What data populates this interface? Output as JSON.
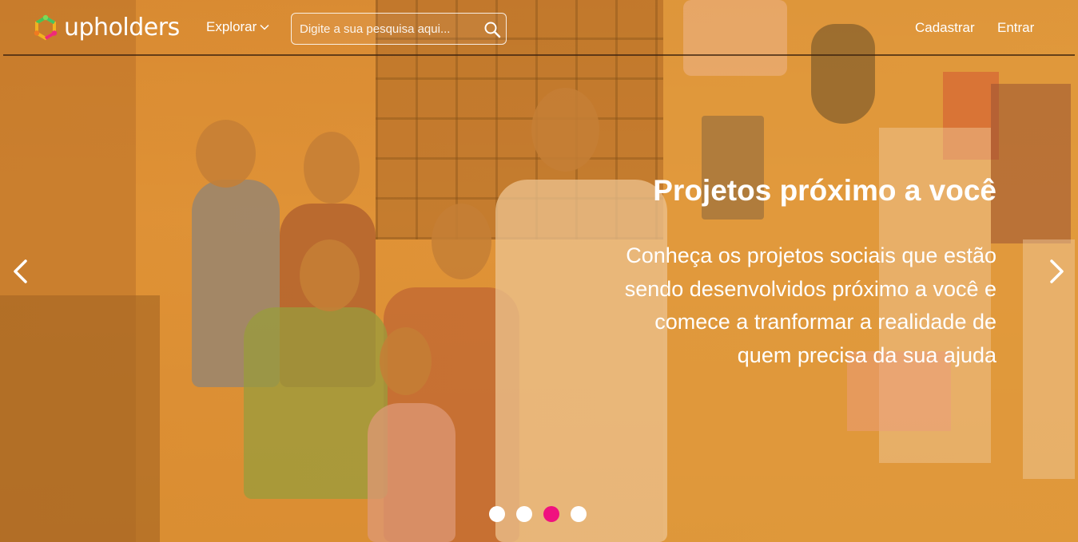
{
  "brand": {
    "name": "upholders",
    "logo_icon": "hexagon-logo-icon"
  },
  "nav": {
    "explore_label": "Explorar",
    "explore_icon": "chevron-down-icon",
    "search_placeholder": "Digite a sua pesquisa aqui...",
    "search_icon": "search-icon",
    "signup_label": "Cadastrar",
    "login_label": "Entrar"
  },
  "slide": {
    "title": "Projetos próximo a você",
    "description_lines": [
      "Conheça os projetos sociais que estão",
      "sendo desenvolvidos próximo a você e",
      "comece a tranformar a realidade de",
      "quem precisa da sua ajuda"
    ],
    "prev_icon": "chevron-left-icon",
    "next_icon": "chevron-right-icon"
  },
  "carousel": {
    "slide_count": 4,
    "active_index": 2
  },
  "colors": {
    "accent": "#f0127f",
    "overlay": "#e89628",
    "text": "#ffffff"
  }
}
